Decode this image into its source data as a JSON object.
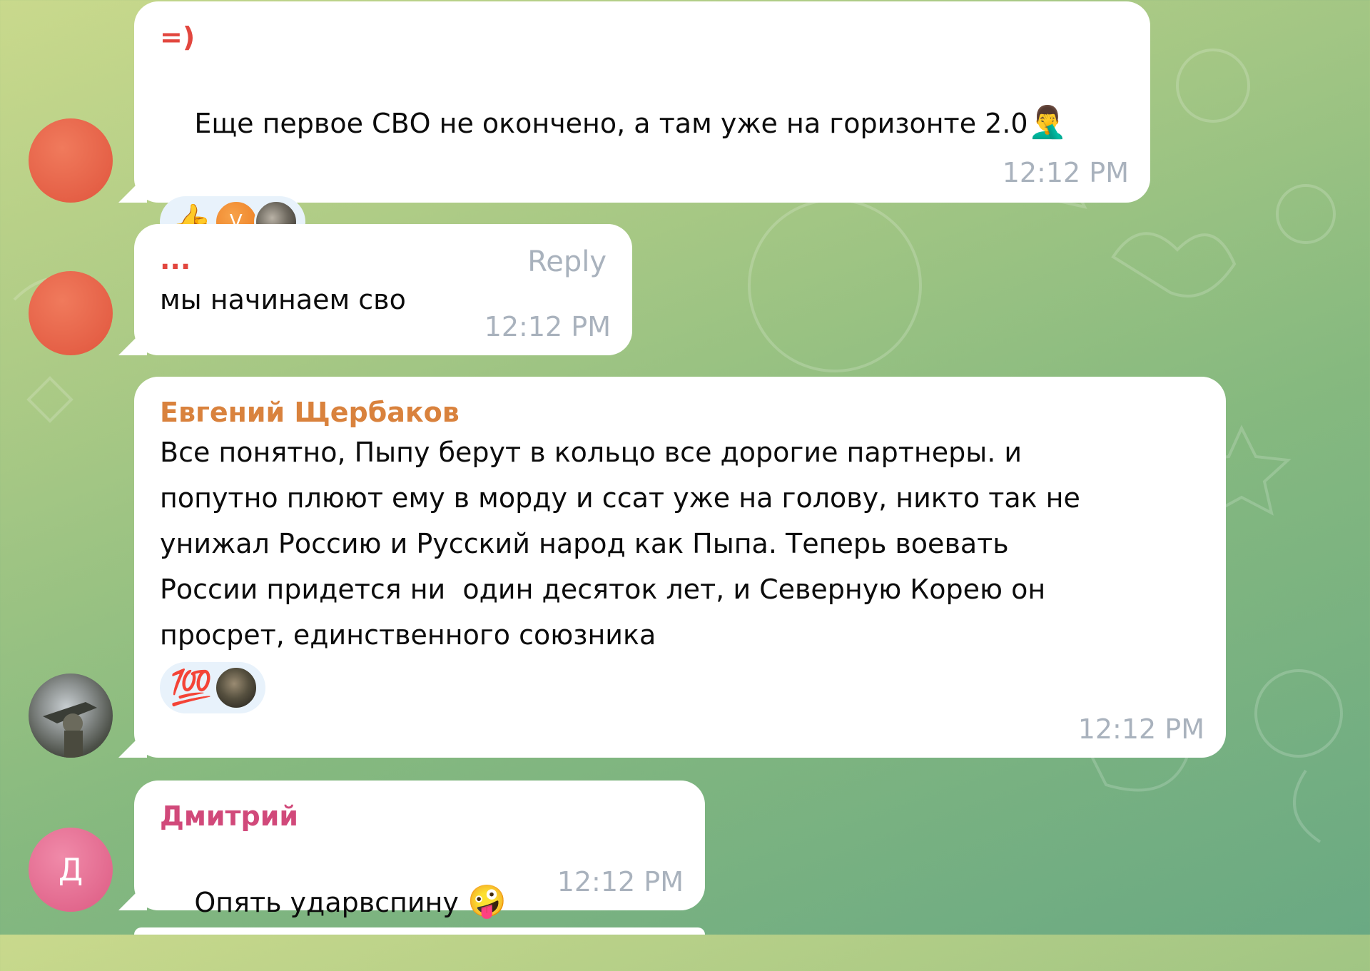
{
  "messages": [
    {
      "sender": "=)",
      "sender_color": "#e2473f",
      "text": "Еще первое СВО не окончено, а там уже на горизонте 2.0",
      "trailing_emoji": "🤦‍♂️",
      "reactions": {
        "emoji": "👍",
        "avatar_initial": "V"
      },
      "time": "12:12 PM"
    },
    {
      "sender": "...",
      "sender_color": "#e2473f",
      "text": "мы начинаем сво",
      "reply_label": "Reply",
      "time": "12:12 PM"
    },
    {
      "sender": "Евгений Щербаков",
      "sender_color": "#d9823d",
      "text": "Все понятно, Пыпу берут в кольцо все дорогие партнеры. и\nпопутно плюют ему в морду и ссат уже на голову, никто так не\nунижал Россию и Русский народ как Пыпа. Теперь воевать\nРоссии придется ни  один десяток лет, и Северную Корею он\nпросрет, единственного союзника",
      "reactions": {
        "emoji": "💯"
      },
      "time": "12:12 PM"
    },
    {
      "sender": "Дмитрий",
      "sender_color": "#d1497a",
      "text": "Опять ударвспину",
      "trailing_emoji": "🤪",
      "avatar_initial": "Д",
      "time": "12:12 PM"
    }
  ]
}
